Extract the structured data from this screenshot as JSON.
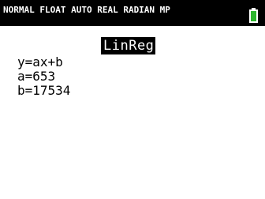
{
  "status_bar": {
    "text": "NORMAL FLOAT AUTO REAL RADIAN MP",
    "battery_icon": "battery-icon",
    "battery_color": "#2db52d"
  },
  "screen": {
    "title": "LinReg",
    "lines": [
      "y=ax+b",
      "a=653",
      "b=17534"
    ]
  }
}
